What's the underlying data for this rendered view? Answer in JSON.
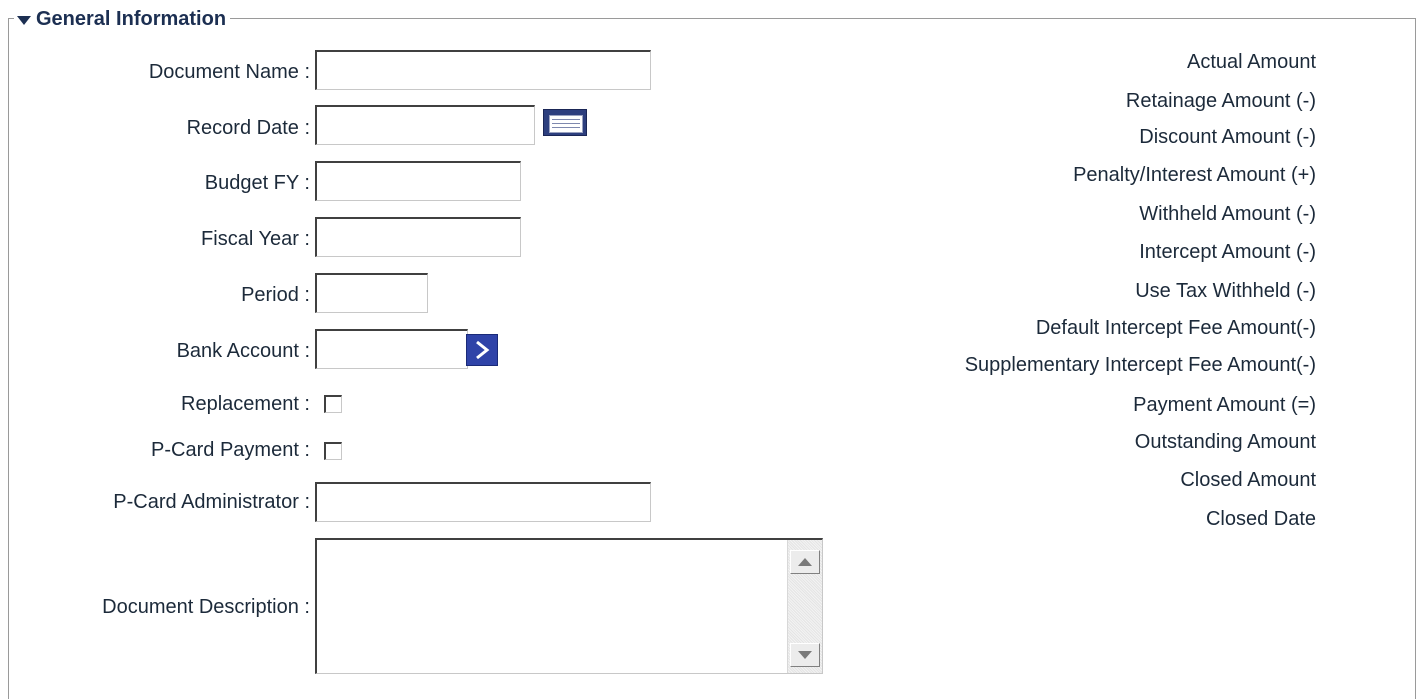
{
  "section": {
    "title": "General Information"
  },
  "left_fields": {
    "document_name": {
      "label": "Document Name :",
      "value": ""
    },
    "record_date": {
      "label": "Record Date :",
      "value": ""
    },
    "budget_fy": {
      "label": "Budget FY :",
      "value": ""
    },
    "fiscal_year": {
      "label": "Fiscal Year :",
      "value": ""
    },
    "period": {
      "label": "Period :",
      "value": ""
    },
    "bank_account": {
      "label": "Bank Account :",
      "value": ""
    },
    "replacement": {
      "label": "Replacement :",
      "checked": false
    },
    "pcard_payment": {
      "label": "P-Card Payment :",
      "checked": false
    },
    "pcard_administrator": {
      "label": "P-Card Administrator :",
      "value": ""
    },
    "document_description": {
      "label": "Document Description :",
      "value": ""
    }
  },
  "right_labels": [
    "Actual Amount",
    "Retainage Amount (-)",
    "Discount Amount (-)",
    "Penalty/Interest Amount (+)",
    "Withheld Amount (-)",
    "Intercept Amount (-)",
    "Use Tax Withheld (-)",
    "Default Intercept Fee Amount(-)",
    "Supplementary Intercept Fee Amount(-)",
    "Payment Amount (=)",
    "Outstanding Amount",
    "Closed Amount",
    "Closed Date"
  ],
  "icons": {
    "collapse": "triangle-down-icon",
    "calendar": "calendar-icon",
    "picker": "chevron-right-icon"
  },
  "colors": {
    "header_text": "#1c2f52",
    "calendar_button": "#2d3f7e",
    "picker_button": "#2f43a8"
  }
}
